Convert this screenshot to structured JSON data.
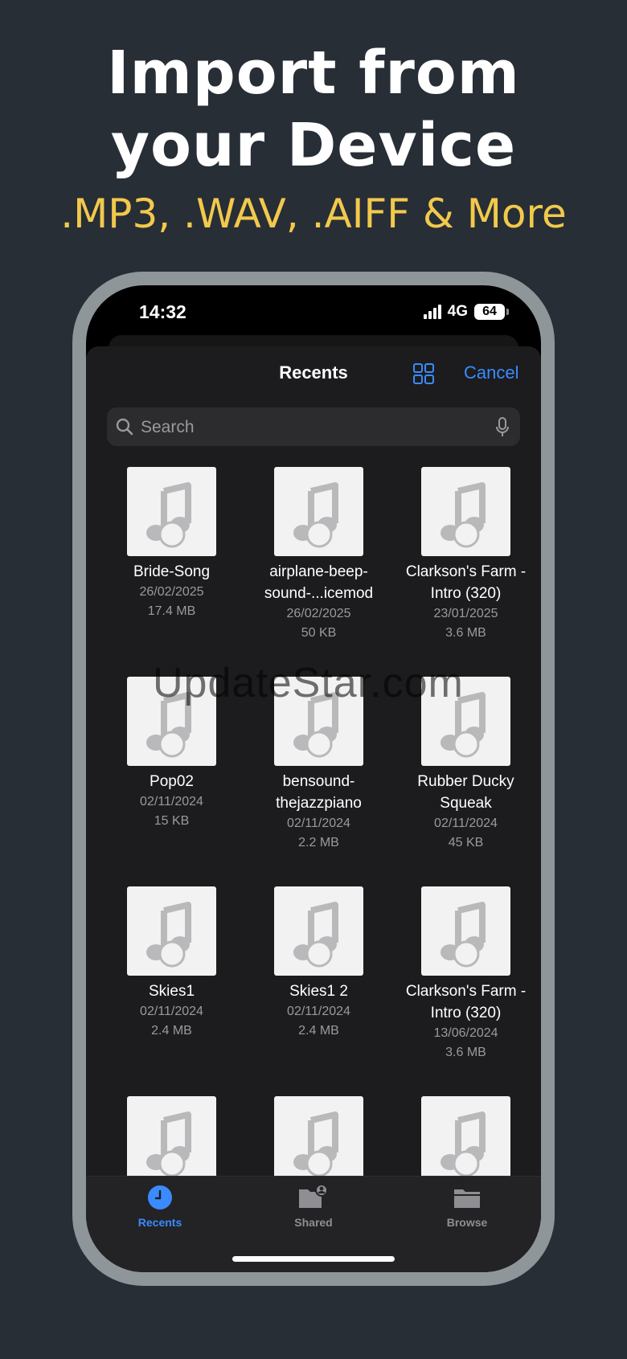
{
  "promo": {
    "headline_line1": "Import from",
    "headline_line2": "your Device",
    "subline": ".MP3, .WAV, .AIFF & More"
  },
  "status_bar": {
    "time": "14:32",
    "network": "4G",
    "battery": "64"
  },
  "nav": {
    "title": "Recents",
    "cancel_label": "Cancel",
    "grid_icon": "grid-view-icon"
  },
  "search": {
    "placeholder": "Search",
    "value": ""
  },
  "files": [
    {
      "name": "Bride-Song",
      "date": "26/02/2025",
      "size": "17.4 MB"
    },
    {
      "name": "airplane-beep-\nsound-...icemod",
      "date": "26/02/2025",
      "size": "50 KB"
    },
    {
      "name": "Clarkson's Farm -\nIntro (320)",
      "date": "23/01/2025",
      "size": "3.6 MB"
    },
    {
      "name": "Pop02",
      "date": "02/11/2024",
      "size": "15 KB"
    },
    {
      "name": "bensound-\nthejazzpiano",
      "date": "02/11/2024",
      "size": "2.2 MB"
    },
    {
      "name": "Rubber Ducky\nSqueak",
      "date": "02/11/2024",
      "size": "45 KB"
    },
    {
      "name": "Skies1",
      "date": "02/11/2024",
      "size": "2.4 MB"
    },
    {
      "name": "Skies1 2",
      "date": "02/11/2024",
      "size": "2.4 MB"
    },
    {
      "name": "Clarkson's Farm -\nIntro (320)",
      "date": "13/06/2024",
      "size": "3.6 MB"
    },
    {
      "name": "",
      "date": "",
      "size": ""
    },
    {
      "name": "",
      "date": "",
      "size": ""
    },
    {
      "name": "",
      "date": "",
      "size": ""
    }
  ],
  "tabs": [
    {
      "label": "Recents",
      "icon": "clock-icon",
      "active": true
    },
    {
      "label": "Shared",
      "icon": "shared-folder-icon",
      "active": false
    },
    {
      "label": "Browse",
      "icon": "folder-icon",
      "active": false
    }
  ],
  "watermark": "UpdateStar.com",
  "colors": {
    "background": "#282e36",
    "accent": "#3a8bff",
    "subline": "#f2c94c",
    "inactive_tab": "#8e8e93"
  }
}
